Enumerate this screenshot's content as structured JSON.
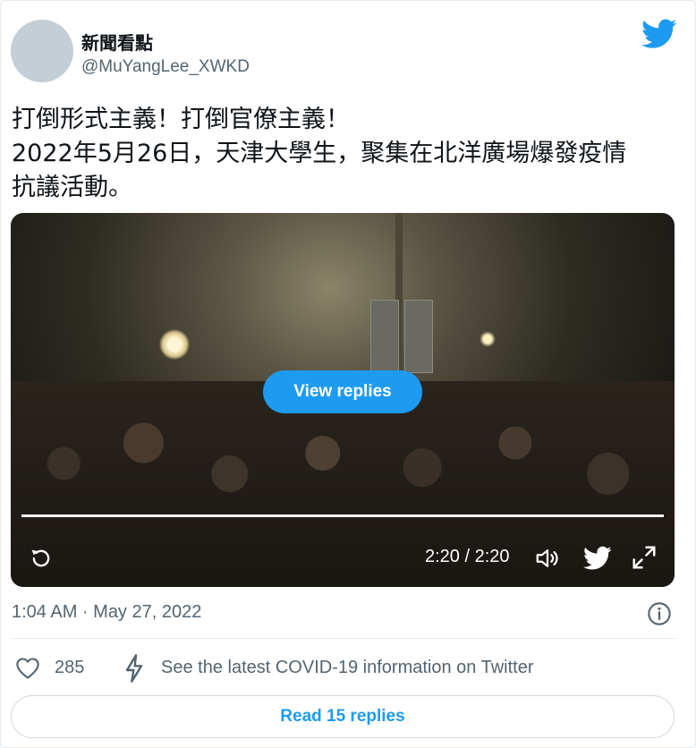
{
  "author": {
    "name": "新聞看點",
    "handle": "@MuYangLee_XWKD"
  },
  "tweet": {
    "lines": [
      "打倒形式主義！打倒官僚主義！",
      "2022年5月26日，天津大學生，聚集在北洋廣場爆發疫情",
      "抗議活動。"
    ]
  },
  "media": {
    "view_replies_label": "View replies",
    "time_display": "2:20 / 2:20",
    "progress": 1.0
  },
  "meta": {
    "timestamp": "1:04 AM · May 27, 2022"
  },
  "actions": {
    "like_count": "285",
    "covid_text": "See the latest COVID-19 information on Twitter"
  },
  "footer": {
    "read_replies_label": "Read 15 replies"
  },
  "colors": {
    "accent": "#1d9bf0",
    "secondary_text": "#536471"
  },
  "icons": [
    "twitter-bird-icon",
    "replay-icon",
    "volume-icon",
    "twitter-icon",
    "fullscreen-icon",
    "info-icon",
    "heart-icon",
    "lightning-icon"
  ]
}
